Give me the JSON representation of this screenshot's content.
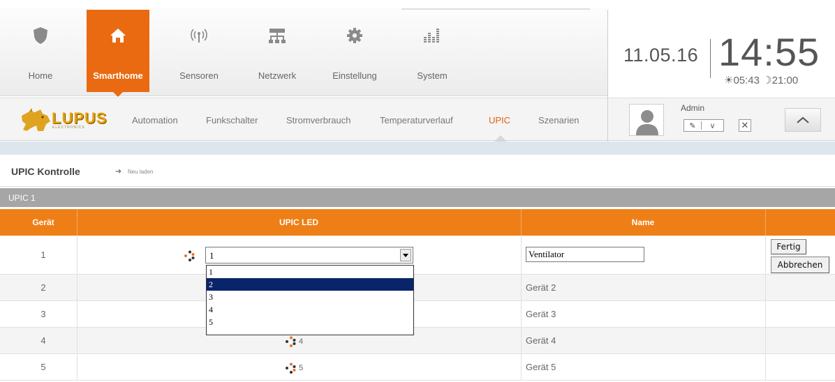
{
  "nav": {
    "items": [
      {
        "label": "Home",
        "icon": "shield-icon"
      },
      {
        "label": "Smarthome",
        "icon": "house-icon"
      },
      {
        "label": "Sensoren",
        "icon": "antenna-icon"
      },
      {
        "label": "Netzwerk",
        "icon": "network-icon"
      },
      {
        "label": "Einstellung",
        "icon": "gear-icon"
      },
      {
        "label": "System",
        "icon": "equalizer-icon"
      }
    ],
    "active": "Smarthome"
  },
  "clock": {
    "date": "11.05.16",
    "time": "14:55",
    "sunrise": "05:43",
    "sunset": "21:00"
  },
  "brand": {
    "name": "LUPUS",
    "tagline": "ELECTRONICS"
  },
  "subnav": {
    "items": [
      "Automation",
      "Funkschalter",
      "Stromverbrauch",
      "Temperaturverlauf",
      "UPIC",
      "Szenarien"
    ],
    "active": "UPIC"
  },
  "user": {
    "name": "Admin"
  },
  "panel": {
    "title": "UPIC Kontrolle",
    "reload_label": "Neu laden",
    "section": "UPIC 1"
  },
  "table": {
    "headers": [
      "Gerät",
      "UPIC LED",
      "Name"
    ],
    "rows": [
      {
        "nr": "1",
        "led": "1",
        "name": "Ventilator"
      },
      {
        "nr": "2",
        "led": "2",
        "name": "Gerät 2"
      },
      {
        "nr": "3",
        "led": "3",
        "name": "Gerät 3"
      },
      {
        "nr": "4",
        "led": "4",
        "name": "Gerät 4"
      },
      {
        "nr": "5",
        "led": "5",
        "name": "Gerät 5"
      }
    ],
    "edit": {
      "select_value": "1",
      "options": [
        "1",
        "2",
        "3",
        "4",
        "5"
      ],
      "highlighted_option": "2",
      "name_value": "Ventilator",
      "save_label": "Fertig",
      "cancel_label": "Abbrechen"
    }
  },
  "colors": {
    "accent": "#ea6a12",
    "table_header": "#ee7f16",
    "section_bar": "#a6a6a6",
    "dropdown_selection": "#0a246a"
  }
}
